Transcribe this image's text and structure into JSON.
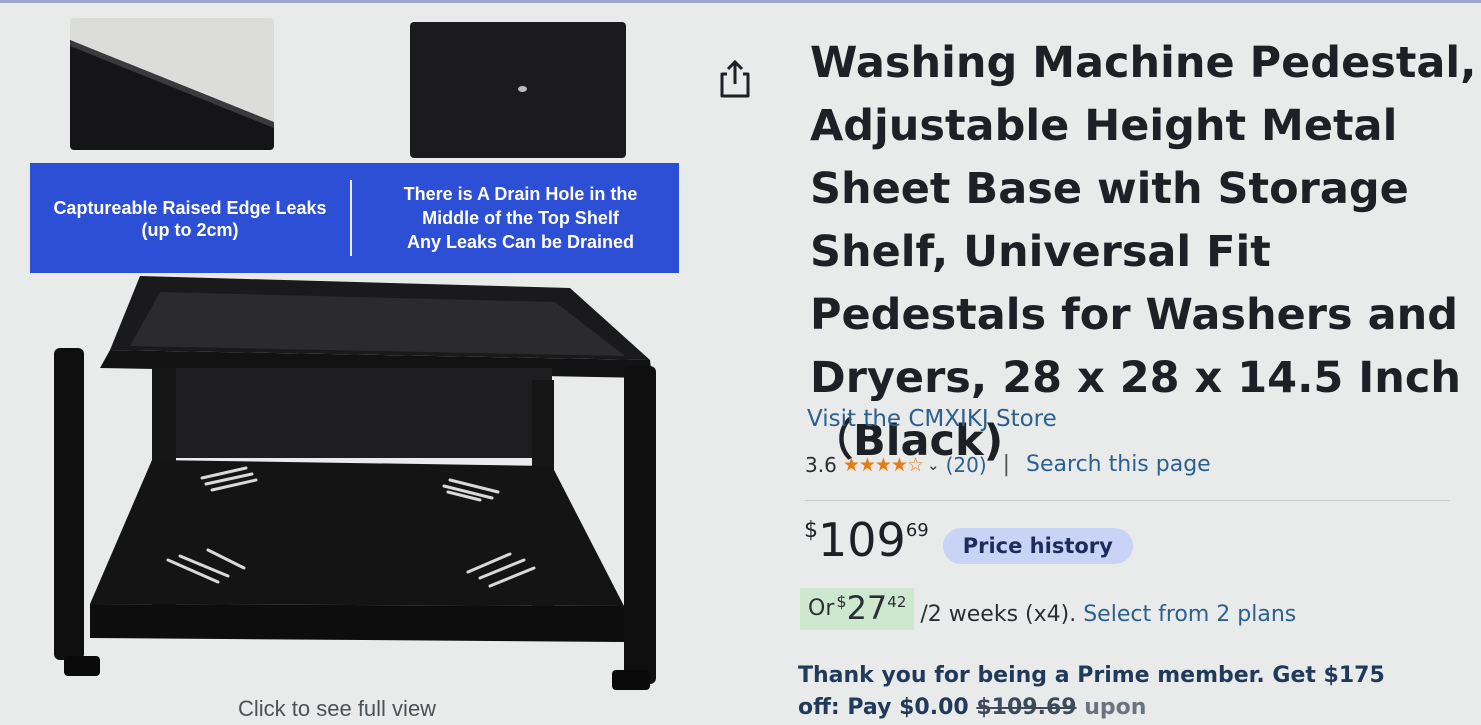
{
  "gallery": {
    "banner_left_lines": [
      "Captureable Raised Edge Leaks",
      "(up to 2cm)"
    ],
    "banner_right_lines": [
      "There is A Drain Hole in the",
      "Middle of the Top Shelf",
      "Any Leaks Can be Drained"
    ],
    "see_full_view": "Click to see full view"
  },
  "product": {
    "title": "Washing Machine Pedestal, Adjustable Height Metal Sheet Base with Storage Shelf, Universal Fit Pedestals for Washers and Dryers, 28 x 28 x 14.5 Inch （Black)",
    "store_link": "Visit the CMXIKJ Store",
    "rating_value": "3.6",
    "rating_stars": 3.6,
    "reviews_count": "(20)",
    "separator": "|",
    "search_page": "Search this page"
  },
  "price": {
    "symbol": "$",
    "whole": "109",
    "fraction": "69",
    "history_button": "Price history"
  },
  "installment": {
    "or_label": "Or",
    "symbol": "$",
    "whole": "27",
    "fraction": "42",
    "period_text": "/2 weeks (x4).",
    "plans_link": "Select from 2 plans"
  },
  "prime": {
    "line1": "Thank you for being a Prime member. Get $175",
    "line2_prefix": "off: Pay $0.00",
    "line2_strike": "$109.69",
    "line2_suffix": "upon"
  },
  "colors": {
    "banner_blue": "#2c4fd6",
    "link_blue": "#2a5f8f",
    "star_orange": "#e77a13",
    "installment_green": "#cde8cf",
    "price_history_bg": "#c9d3f5"
  },
  "icons": [
    "share-icon",
    "chevron-down-icon",
    "star-icon"
  ]
}
